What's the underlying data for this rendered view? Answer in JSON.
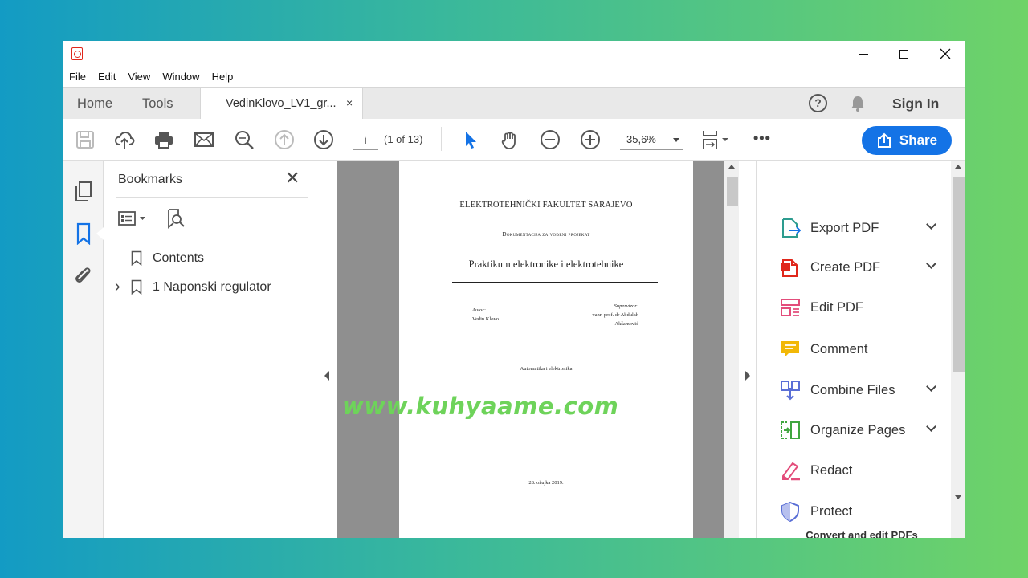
{
  "menu": [
    "File",
    "Edit",
    "View",
    "Window",
    "Help"
  ],
  "tabs": {
    "home": "Home",
    "tools": "Tools",
    "document": "VedinKlovo_LV1_gr...",
    "close_glyph": "×"
  },
  "header": {
    "sign_in": "Sign In",
    "help_glyph": "?"
  },
  "toolbar": {
    "page_value": "i",
    "page_count": "(1 of 13)",
    "zoom": "35,6%",
    "more": "•••",
    "share_label": "Share"
  },
  "bookmarks": {
    "title": "Bookmarks",
    "close_glyph": "✕",
    "expand_glyph": "›",
    "items": [
      {
        "label": "Contents"
      },
      {
        "label": "1 Naponski regulator"
      }
    ]
  },
  "document_page": {
    "university": "ELEKTROTEHNIČKI FAKULTET SARAJEVO",
    "doc_type": "Dokumentacija za vođeni projekat",
    "title": "Praktikum elektronike i elektrotehnike",
    "author_label": "Autor:",
    "author_name": "Vedin Klovo",
    "supervisor_label": "Supervizor:",
    "supervisor_line1": "vanr. prof. dr Abdulah",
    "supervisor_line2": "Akšamović",
    "department": "Automatika i elektronika",
    "date": "28. ožujka 2019."
  },
  "watermark": "www.kuhyaame.com",
  "tools_pane": {
    "items": [
      {
        "label": "Export PDF",
        "icon": "export-pdf-icon",
        "color": "#2d9c8f",
        "has_menu": true
      },
      {
        "label": "Create PDF",
        "icon": "create-pdf-icon",
        "color": "#e0271b",
        "has_menu": true
      },
      {
        "label": "Edit PDF",
        "icon": "edit-pdf-icon",
        "color": "#e34d7b",
        "has_menu": false
      },
      {
        "label": "Comment",
        "icon": "comment-icon",
        "color": "#f2b807",
        "has_menu": false
      },
      {
        "label": "Combine Files",
        "icon": "combine-files-icon",
        "color": "#5a6fd6",
        "has_menu": true
      },
      {
        "label": "Organize Pages",
        "icon": "organize-pages-icon",
        "color": "#3fa63f",
        "has_menu": true
      },
      {
        "label": "Redact",
        "icon": "redact-icon",
        "color": "#e34d7b",
        "has_menu": false
      },
      {
        "label": "Protect",
        "icon": "protect-icon",
        "color": "#5a6fd6",
        "has_menu": false
      }
    ],
    "footer": "Convert and edit PDFs"
  },
  "colors": {
    "accent": "#1473e6",
    "watermark": "#6ed35a",
    "acrobat_red": "#e0271b"
  }
}
